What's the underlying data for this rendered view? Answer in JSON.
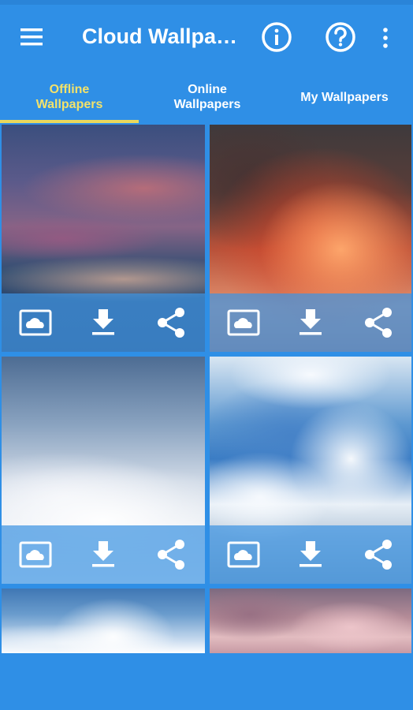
{
  "app": {
    "title": "Cloud Wallpapers",
    "colors": {
      "primary": "#2f8fe6",
      "active_tab": "#f3e26a",
      "tab_indicator": "#e9d85c",
      "action_bar": "#3e94e2"
    }
  },
  "tabs": [
    {
      "label": "Offline\nWallpapers",
      "active": true
    },
    {
      "label": "Online\nWallpapers",
      "active": false
    },
    {
      "label": "My Wallpapers",
      "active": false
    }
  ],
  "cards": [
    {
      "name": "purple-sunset-clouds"
    },
    {
      "name": "red-fire-clouds"
    },
    {
      "name": "white-cloud-sea"
    },
    {
      "name": "cumulus-mountain-clouds"
    },
    {
      "name": "sun-rays-clouds"
    },
    {
      "name": "pink-clouds"
    }
  ],
  "action_icons": [
    "set-wallpaper-icon",
    "download-icon",
    "share-icon"
  ]
}
